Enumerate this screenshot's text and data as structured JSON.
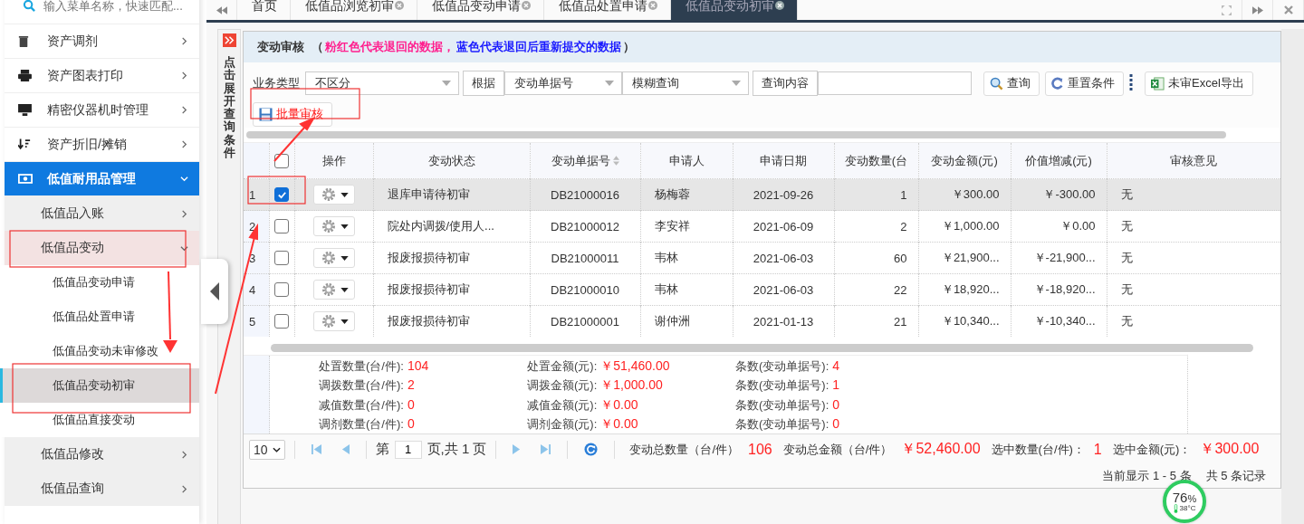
{
  "sidebar": {
    "search": {
      "placeholder": "输入菜单名称，快速匹配..."
    },
    "items": [
      {
        "label": "资产调剂",
        "expanded": false
      },
      {
        "label": "资产图表打印",
        "expanded": false
      },
      {
        "label": "精密仪器机时管理",
        "expanded": false
      },
      {
        "label": "资产折旧/摊销",
        "expanded": false
      },
      {
        "label": "低值耐用品管理",
        "expanded": true,
        "children": [
          {
            "label": "低值品入账",
            "expanded": false
          },
          {
            "label": "低值品变动",
            "expanded": true,
            "children": [
              {
                "label": "低值品变动申请",
                "selected": false
              },
              {
                "label": "低值品处置申请",
                "selected": false
              },
              {
                "label": "低值品变动未审修改",
                "selected": false
              },
              {
                "label": "低值品变动初审",
                "selected": true
              },
              {
                "label": "低值品直接变动",
                "selected": false
              }
            ]
          },
          {
            "label": "低值品修改",
            "expanded": false
          },
          {
            "label": "低值品查询",
            "expanded": false
          }
        ]
      }
    ]
  },
  "tabs": [
    {
      "label": "首页",
      "selected": false,
      "closable": false
    },
    {
      "label": "低值品浏览初审",
      "selected": false,
      "closable": true
    },
    {
      "label": "低值品变动申请",
      "selected": false,
      "closable": true
    },
    {
      "label": "低值品处置申请",
      "selected": false,
      "closable": true
    },
    {
      "label": "低值品变动初审",
      "selected": true,
      "closable": true
    }
  ],
  "query_strip": {
    "label": "点击展开查询条件"
  },
  "header": {
    "title": "变动审核",
    "open": "（",
    "note_returned": "粉红色代表退回的数据，",
    "note_resubmitted": "蓝色代表退回后重新提交的数据",
    "close": "）"
  },
  "filters": {
    "type_label": "业务类型",
    "type_value": "不区分",
    "by_label": "根据",
    "field_value": "变动单据号",
    "mode_value": "模糊查询",
    "content_label": "查询内容",
    "buttons": [
      "查询",
      "重置条件",
      "未审Excel导出"
    ]
  },
  "batch_button": "批量审核",
  "table": {
    "select_all_checked": false,
    "columns": [
      "操作",
      "变动状态",
      "变动单据号",
      "申请人",
      "申请日期",
      "变动数量(台",
      "变动金额(元)",
      "价值增减(元)",
      "审核意见"
    ],
    "rows": [
      {
        "num": "1",
        "checked": true,
        "selected": true,
        "status": "退库申请待初审",
        "doc_no": "DB21000016",
        "applicant": "杨梅蓉",
        "date": "2021-09-26",
        "qty": "1",
        "amount": "￥300.00",
        "change": "￥-300.00",
        "opinion": "无"
      },
      {
        "num": "2",
        "checked": false,
        "selected": false,
        "status": "院处内调拨/使用人...",
        "doc_no": "DB21000012",
        "applicant": "李安祥",
        "date": "2021-06-09",
        "qty": "2",
        "amount": "￥1,000.00",
        "change": "￥0.00",
        "opinion": "无"
      },
      {
        "num": "3",
        "checked": false,
        "selected": false,
        "status": "报废报损待初审",
        "doc_no": "DB21000011",
        "applicant": "韦林",
        "date": "2021-06-03",
        "qty": "60",
        "amount": "￥21,900...",
        "change": "￥-21,900...",
        "opinion": "无"
      },
      {
        "num": "4",
        "checked": false,
        "selected": false,
        "status": "报废报损待初审",
        "doc_no": "DB21000010",
        "applicant": "韦林",
        "date": "2021-06-03",
        "qty": "22",
        "amount": "￥18,920...",
        "change": "￥-18,920...",
        "opinion": "无"
      },
      {
        "num": "5",
        "checked": false,
        "selected": false,
        "status": "报废报损待初审",
        "doc_no": "DB21000001",
        "applicant": "谢仲洲",
        "date": "2021-01-13",
        "qty": "21",
        "amount": "￥10,340...",
        "change": "￥-10,340...",
        "opinion": "无"
      }
    ]
  },
  "summary": [
    {
      "label": "处置数量(台/件):",
      "value": "104"
    },
    {
      "label": "处置金额(元):",
      "value": "￥51,460.00"
    },
    {
      "label": "条数(变动单据号):",
      "value": "4"
    },
    {
      "label": "调拨数量(台/件):",
      "value": "2"
    },
    {
      "label": "调拨金额(元):",
      "value": "￥1,000.00"
    },
    {
      "label": "条数(变动单据号):",
      "value": "1"
    },
    {
      "label": "减值数量(台/件):",
      "value": "0"
    },
    {
      "label": "减值金额(元):",
      "value": "￥0.00"
    },
    {
      "label": "条数(变动单据号):",
      "value": "0"
    },
    {
      "label": "调剂数量(台/件):",
      "value": "0"
    },
    {
      "label": "调剂金额(元):",
      "value": "￥0.00"
    },
    {
      "label": "条数(变动单据号):",
      "value": "0"
    }
  ],
  "pager": {
    "page_size": "10",
    "before": "第",
    "page": "1",
    "after": "页,共 1 页",
    "totals": [
      {
        "label": "变动总数量（台/件）",
        "value": "106"
      },
      {
        "label": "变动总金额（台/件）",
        "value": "￥52,460.00"
      },
      {
        "label": "选中数量(台/件)：",
        "value": "1"
      },
      {
        "label": "选中金额(元)：",
        "value": "￥300.00"
      }
    ],
    "record_start": "当前显示 1 - 5 条",
    "record_end": "共 5 条记录"
  },
  "gauge": {
    "percent": "76",
    "unit": "%",
    "temperature": "38°C"
  }
}
